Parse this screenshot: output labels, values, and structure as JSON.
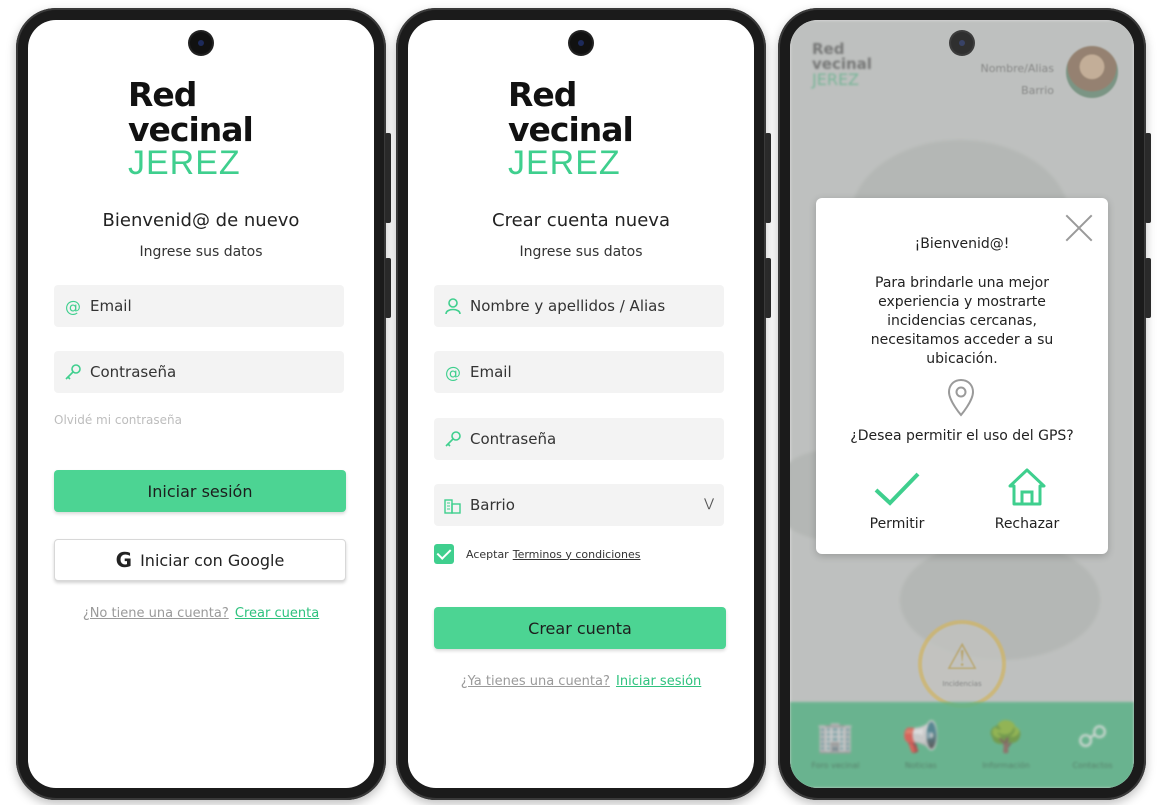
{
  "brand": {
    "line1": "Red",
    "line2": "vecinal",
    "line3": "JEREZ",
    "accent": "#3fcf8e"
  },
  "login": {
    "title": "Bienvenid@ de nuevo",
    "subtitle": "Ingrese sus datos",
    "email_placeholder": "Email",
    "password_placeholder": "Contraseña",
    "forgot": "Olvidé mi contraseña",
    "login_button": "Iniciar sesión",
    "google_button": "Iniciar con Google",
    "no_account": "¿No tiene una cuenta?",
    "create_link": "Crear cuenta"
  },
  "register": {
    "title": "Crear cuenta nueva",
    "subtitle": "Ingrese sus datos",
    "name_placeholder": "Nombre y apellidos / Alias",
    "email_placeholder": "Email",
    "password_placeholder": "Contraseña",
    "barrio_placeholder": "Barrio",
    "accept_label": "Aceptar",
    "terms_link": "Terminos y condiciones",
    "terms_checked": true,
    "create_button": "Crear cuenta",
    "have_account": "¿Ya tienes una cuenta?",
    "login_link": "Iniciar sesión"
  },
  "home": {
    "user_name": "Nombre/Alias",
    "user_barrio": "Barrio",
    "report_label": "Incidencias",
    "nav": [
      "Foro vecinal",
      "Noticias",
      "Información",
      "Contactos"
    ],
    "dialog": {
      "title": "¡Bienvenid@!",
      "body": "Para brindarle una mejor experiencia y mostrarte incidencias cercanas, necesitamos acceder a su ubicación.",
      "question": "¿Desea permitir el uso del GPS?",
      "allow": "Permitir",
      "deny": "Rechazar"
    }
  }
}
